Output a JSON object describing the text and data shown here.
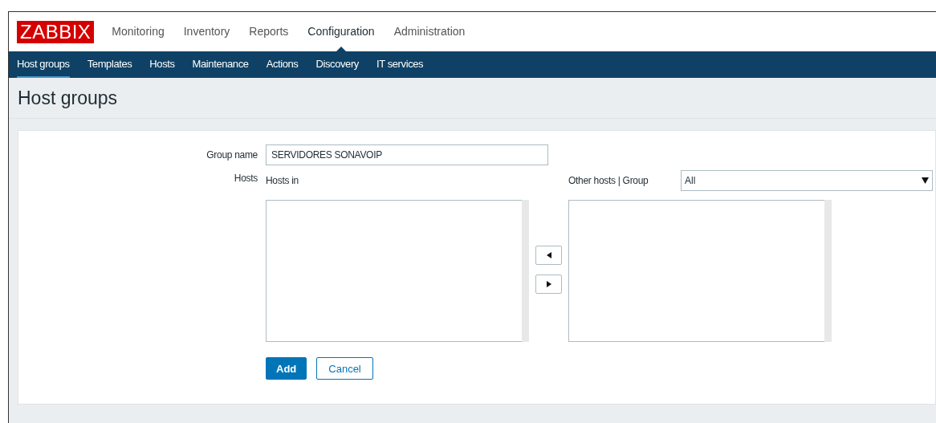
{
  "logo": "ZABBIX",
  "menu": [
    {
      "label": "Monitoring",
      "selected": false
    },
    {
      "label": "Inventory",
      "selected": false
    },
    {
      "label": "Reports",
      "selected": false
    },
    {
      "label": "Configuration",
      "selected": true
    },
    {
      "label": "Administration",
      "selected": false
    }
  ],
  "submenu": [
    {
      "label": "Host groups",
      "selected": true
    },
    {
      "label": "Templates",
      "selected": false
    },
    {
      "label": "Hosts",
      "selected": false
    },
    {
      "label": "Maintenance",
      "selected": false
    },
    {
      "label": "Actions",
      "selected": false
    },
    {
      "label": "Discovery",
      "selected": false
    },
    {
      "label": "IT services",
      "selected": false
    }
  ],
  "page_title": "Host groups",
  "form": {
    "group_name_label": "Group name",
    "group_name_value": "SERVIDORES SONAVOIP",
    "hosts_label": "Hosts",
    "hosts_in_label": "Hosts in",
    "other_hosts_label": "Other hosts | Group",
    "group_select_value": "All"
  },
  "buttons": [
    {
      "label": "Add",
      "kind": "primary"
    },
    {
      "label": "Cancel",
      "kind": "secondary"
    }
  ]
}
